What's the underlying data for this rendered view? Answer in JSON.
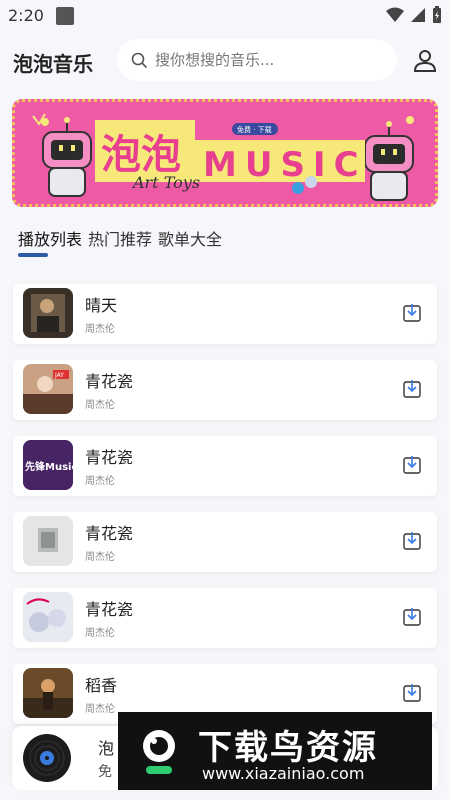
{
  "status": {
    "time": "2:20"
  },
  "header": {
    "title": "泡泡音乐",
    "search_placeholder": "搜你想搜的音乐..."
  },
  "banner": {
    "title_cn": "泡泡",
    "title_en": "MUSIC",
    "subtitle": "Art Toys",
    "badge": "免费 · 下载"
  },
  "tabs": [
    {
      "label": "播放列表",
      "active": true
    },
    {
      "label": "热门推荐",
      "active": false
    },
    {
      "label": "歌单大全",
      "active": false
    }
  ],
  "songs": [
    {
      "title": "晴天",
      "artist": "周杰伦"
    },
    {
      "title": "青花瓷",
      "artist": "周杰伦"
    },
    {
      "title": "青花瓷",
      "artist": "周杰伦"
    },
    {
      "title": "青花瓷",
      "artist": "周杰伦"
    },
    {
      "title": "青花瓷",
      "artist": "周杰伦"
    },
    {
      "title": "稻香",
      "artist": "周杰伦"
    }
  ],
  "covers": {
    "cover3_text": "先锋Music",
    "cover2_text": "JAY"
  },
  "player": {
    "title": "泡",
    "subtitle": "免"
  },
  "watermark": {
    "title": "下载鸟资源",
    "url": "www.xiazainiao.com"
  },
  "colors": {
    "accent": "#2c5ca8",
    "banner_pink": "#ef5aa7",
    "banner_yellow": "#f6e97a"
  }
}
